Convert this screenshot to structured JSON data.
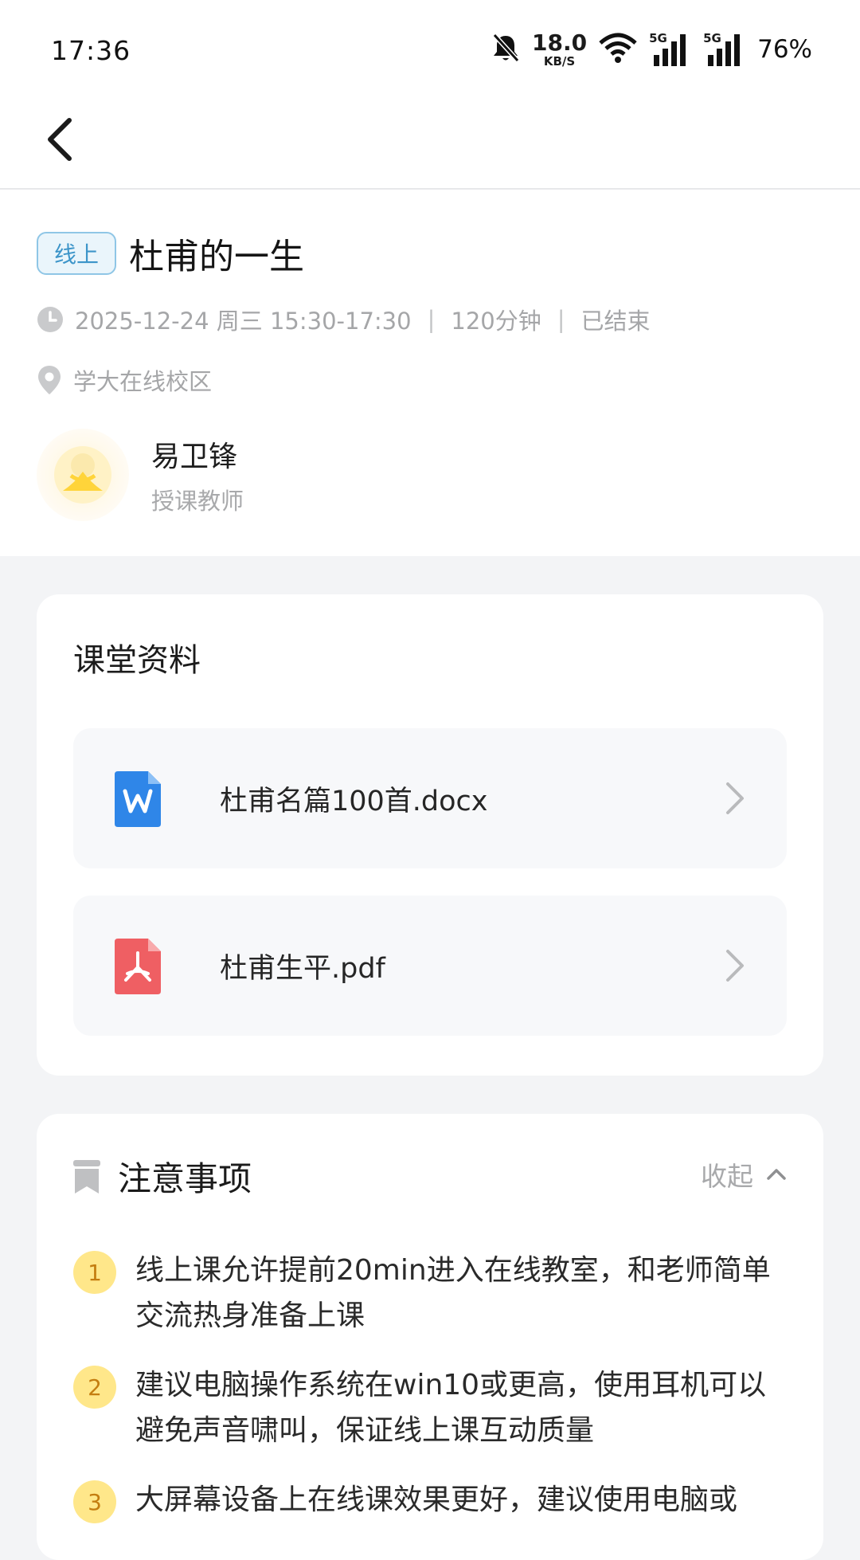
{
  "status": {
    "time": "17:36",
    "speed_value": "18.0",
    "speed_unit": "KB/S",
    "net1": "5G",
    "net2": "5G",
    "battery": "76%"
  },
  "course": {
    "tag": "线上",
    "title": "杜甫的一生",
    "date": "2025-12-24 周三  15:30-17:30",
    "duration": "120分钟",
    "status": "已结束",
    "location": "学大在线校区"
  },
  "teacher": {
    "name": "易卫锋",
    "role": "授课教师"
  },
  "materials": {
    "title": "课堂资料",
    "files": [
      {
        "name": "杜甫名篇100首.docx",
        "type": "word"
      },
      {
        "name": "杜甫生平.pdf",
        "type": "pdf"
      }
    ]
  },
  "notes": {
    "title": "注意事项",
    "collapse_label": "收起",
    "items": [
      {
        "num": "1",
        "text": "线上课允许提前20min进入在线教室，和老师简单交流热身准备上课"
      },
      {
        "num": "2",
        "text": "建议电脑操作系统在win10或更高，使用耳机可以避免声音啸叫，保证线上课互动质量"
      },
      {
        "num": "3",
        "text": "大屏幕设备上在线课效果更好，建议使用电脑或"
      }
    ]
  },
  "colors": {
    "tag_blue": "#3d95c9",
    "word_blue": "#2f86e8",
    "pdf_red": "#ef5f63",
    "number_yellow": "#ffe78a"
  }
}
